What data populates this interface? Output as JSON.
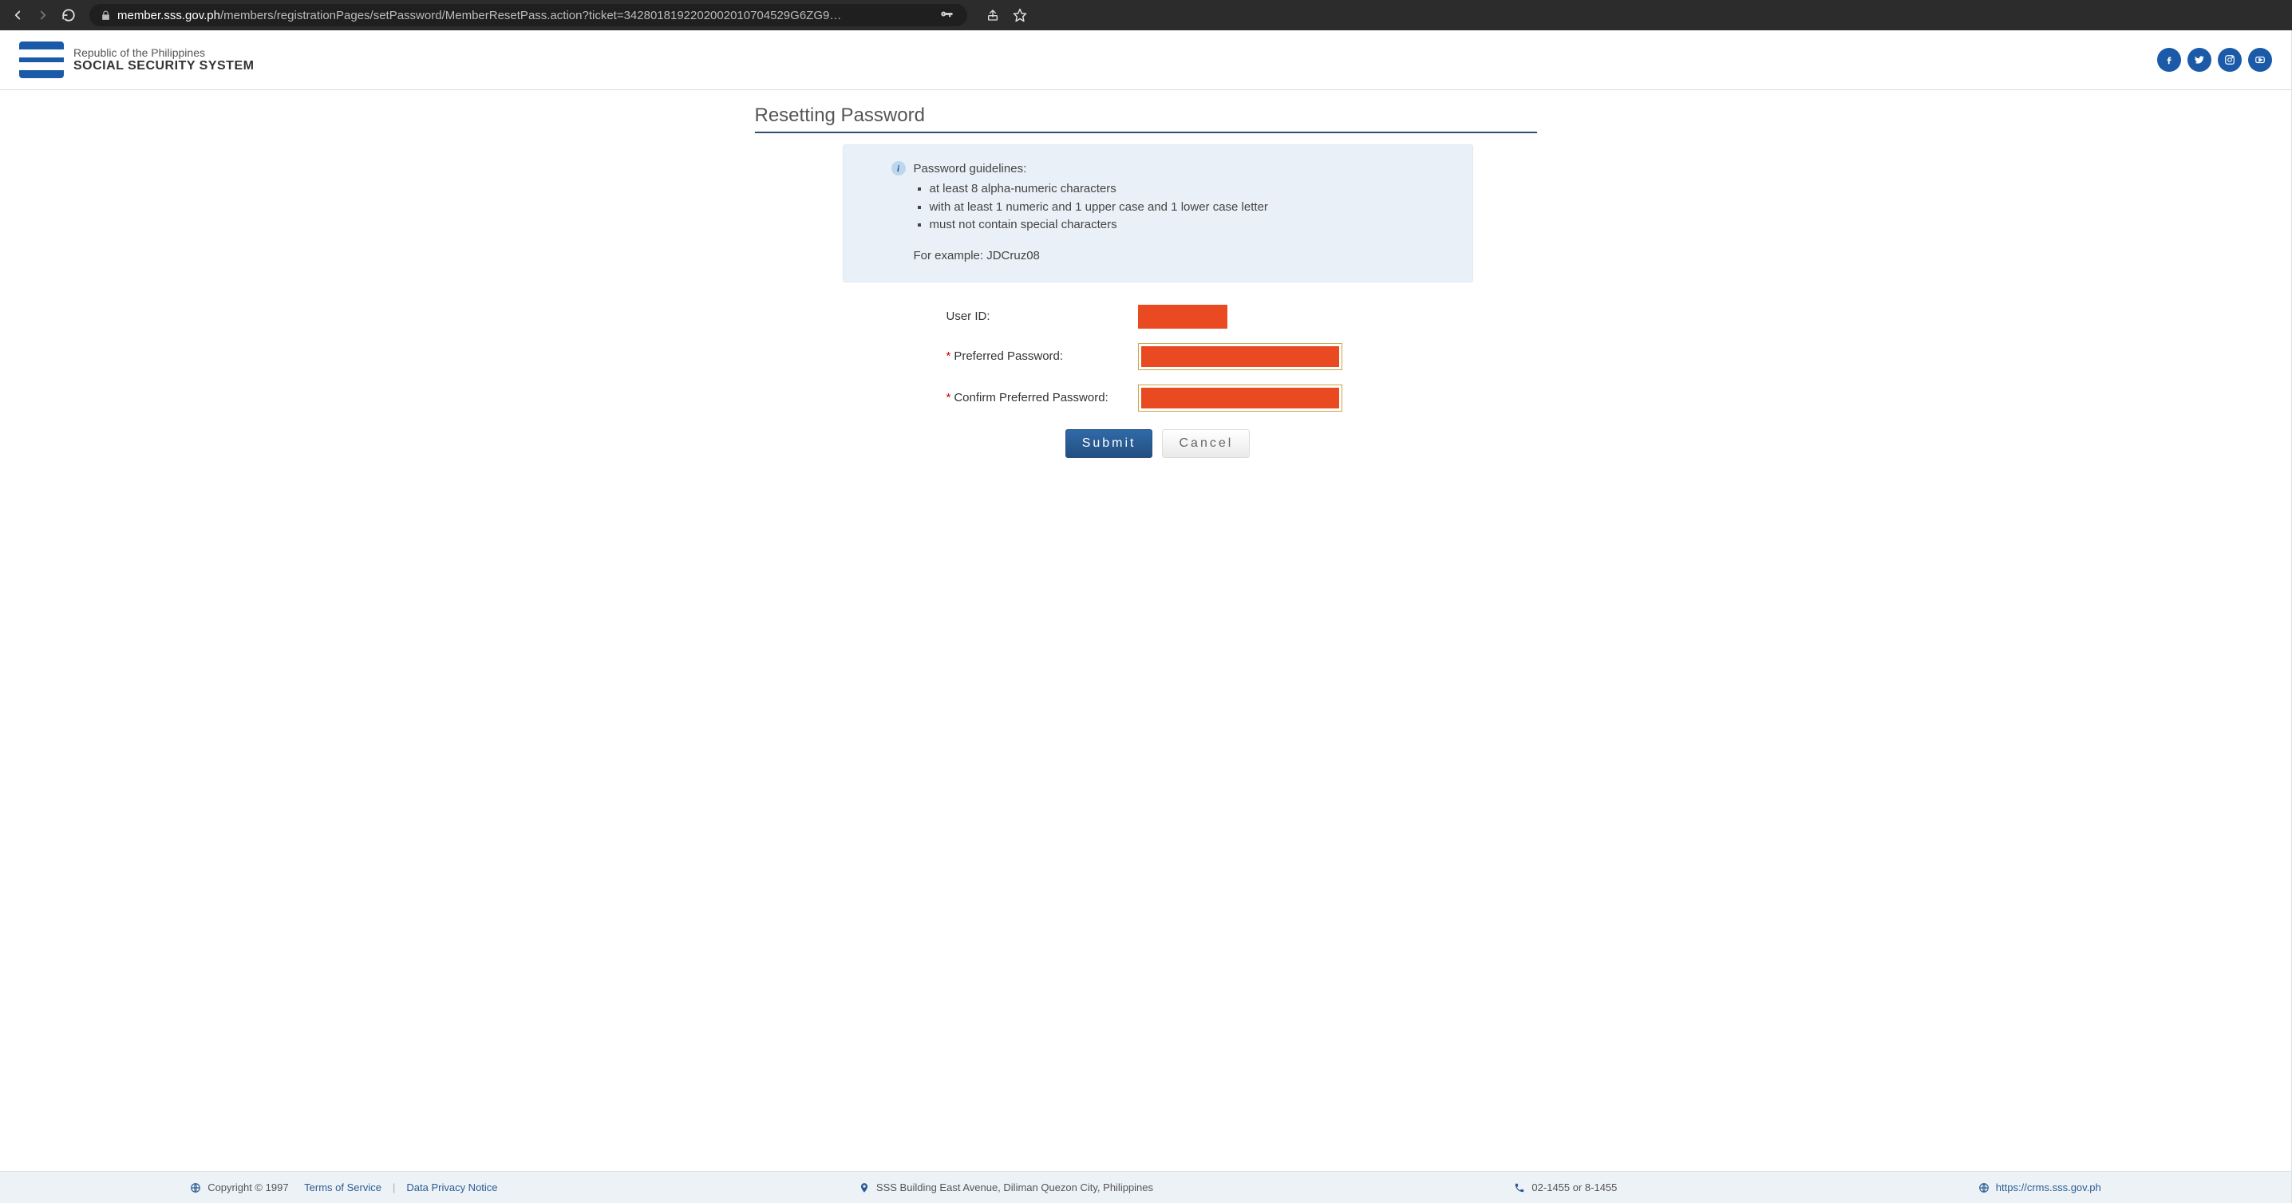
{
  "browser": {
    "url_host": "member.sss.gov.ph",
    "url_path": "/members/registrationPages/setPassword/MemberResetPass.action?ticket=34280181922020020107045​29G6ZG9…"
  },
  "header": {
    "brand_line1": "Republic of the Philippines",
    "brand_line2": "SOCIAL SECURITY SYSTEM"
  },
  "page": {
    "title": "Resetting Password"
  },
  "info": {
    "title": "Password guidelines:",
    "rules": [
      "at least 8 alpha-numeric characters",
      "with at least 1 numeric and 1 upper case and 1 lower case letter",
      "must not contain special characters"
    ],
    "example": "For example: JDCruz08"
  },
  "form": {
    "user_id_label": "User ID:",
    "preferred_password_label": "Preferred Password:",
    "confirm_password_label": "Confirm Preferred Password:",
    "submit_label": "Submit",
    "cancel_label": "Cancel"
  },
  "footer": {
    "copyright": "Copyright © 1997",
    "tos": "Terms of Service",
    "privacy": "Data Privacy Notice",
    "address": "SSS Building East Avenue, Diliman Quezon City, Philippines",
    "phone": "02-1455 or 8-1455",
    "link": "https://crms.sss.gov.ph"
  },
  "colors": {
    "brand_blue": "#1a5aa8",
    "redact": "#ea4a22"
  }
}
